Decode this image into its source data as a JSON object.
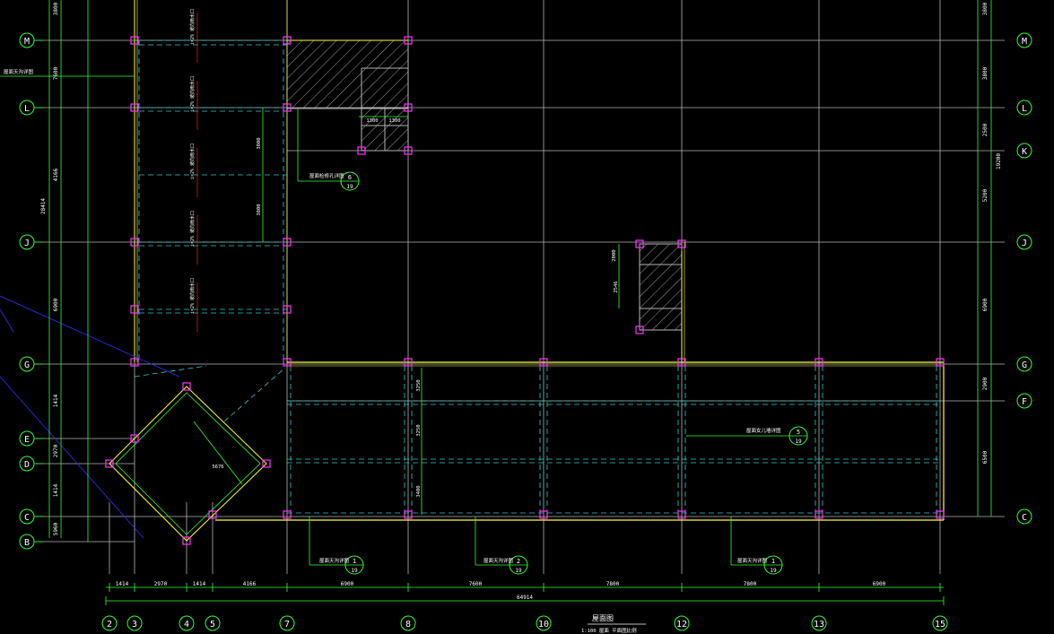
{
  "drawing": {
    "title": "屋面图",
    "subtitle": "1:100  屋面  平面图比例",
    "left_grid_labels": [
      "M",
      "L",
      "J",
      "G",
      "E",
      "D",
      "C",
      "B"
    ],
    "right_grid_labels": [
      "M",
      "L",
      "K",
      "J",
      "G",
      "F",
      "C"
    ],
    "bottom_grid_labels": [
      "2",
      "3",
      "4",
      "5",
      "7",
      "8",
      "10",
      "12",
      "13",
      "15"
    ],
    "left_dims": [
      "3800",
      "7600",
      "4166",
      "1414",
      "2970",
      "1414",
      "5960",
      "6900",
      "28414"
    ],
    "right_dims": [
      "3800",
      "3800",
      "2500",
      "5200",
      "6900",
      "2900",
      "6500",
      "19200"
    ],
    "bottom_dims": [
      "1414",
      "2970",
      "1414",
      "4166",
      "6900",
      "7600",
      "7800",
      "7800",
      "6900"
    ],
    "bottom_total": "64914",
    "detail_refs": [
      {
        "num": "6",
        "sheet": "19",
        "text": "屋面检修孔详图"
      },
      {
        "num": "5",
        "sheet": "19",
        "text": "屋面女儿墙详图"
      },
      {
        "num": "1",
        "sheet": "19",
        "text": "屋面天沟详图"
      },
      {
        "num": "2",
        "sheet": "19",
        "text": "屋面天沟详图"
      },
      {
        "num": "1",
        "sheet": "19",
        "text": "屋面天沟详图"
      }
    ],
    "slope_notes": [
      "i=2% 坡向雨水口",
      "i=2% 坡向雨水口",
      "i=2% 坡向雨水口",
      "i=2% 坡向雨水口",
      "i=2% 坡向雨水口"
    ],
    "inner_dims": [
      "3800",
      "3800",
      "1300",
      "1300",
      "1300",
      "2546",
      "2000",
      "3250",
      "3250",
      "3400",
      "5676"
    ],
    "left_callout": "屋面天沟详图",
    "colors": {
      "grid": "#b5b5b5",
      "dim": "#33ff33",
      "wall": "#ffff33",
      "column": "#ff33ff",
      "dashed": "#33cccc",
      "hatch": "#c8c8c8",
      "axis_ring": "#33ff33",
      "blue": "#3030ff"
    }
  }
}
